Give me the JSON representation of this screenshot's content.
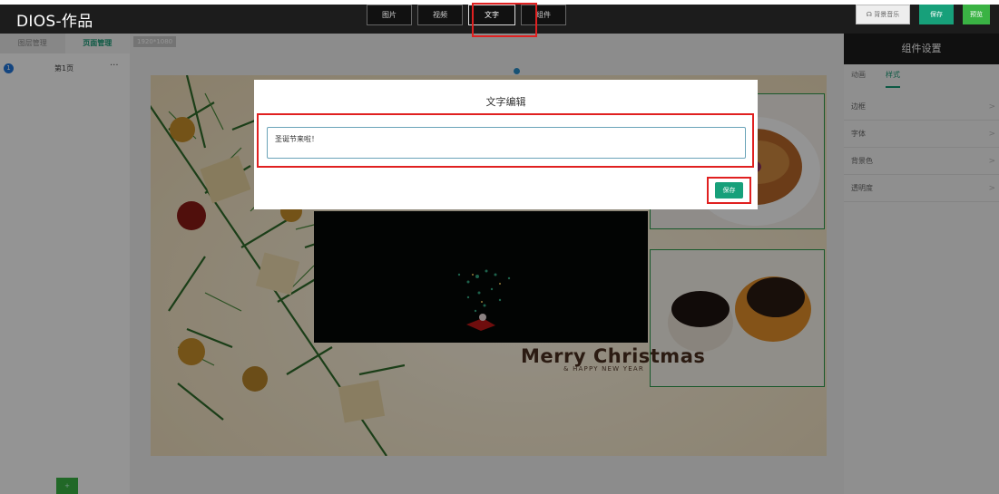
{
  "app": {
    "title": "DIOS-作品"
  },
  "top_toolbar": {
    "tabs": [
      {
        "label": "图片"
      },
      {
        "label": "视频"
      },
      {
        "label": "文字"
      },
      {
        "label": "组件"
      }
    ],
    "active_tab": "文字",
    "music_label": "☊ 背景音乐",
    "save_label": "保存",
    "preview_label": "预览"
  },
  "left_panel": {
    "tabs": [
      {
        "label": "图层管理"
      },
      {
        "label": "页面管理"
      }
    ],
    "active_tab": "页面管理",
    "pages": [
      {
        "number": "1",
        "label": "第1页",
        "menu": "···"
      }
    ],
    "add_label": "+"
  },
  "canvas": {
    "size_label": "1920*1080",
    "headline": "Merry Christmas",
    "subline": "& HAPPY NEW YEAR"
  },
  "right_panel": {
    "header": "组件设置",
    "tabs": [
      {
        "label": "动画"
      },
      {
        "label": "样式"
      }
    ],
    "active_tab": "样式",
    "properties": [
      {
        "label": "边框",
        "chevron": ">"
      },
      {
        "label": "字体",
        "chevron": ">"
      },
      {
        "label": "背景色",
        "chevron": ">"
      },
      {
        "label": "透明度",
        "chevron": ">"
      }
    ]
  },
  "modal": {
    "title": "文字编辑",
    "input_value": "圣诞节来啦！",
    "save_label": "保存"
  },
  "colors": {
    "accent_green": "#17a07a",
    "preview_green": "#3ab344",
    "highlight_red": "#e02020",
    "topbar_bg": "#1c1c1c"
  }
}
